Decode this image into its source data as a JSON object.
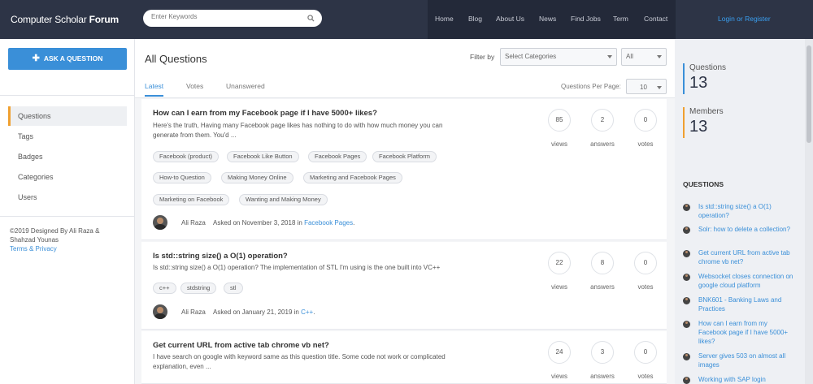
{
  "header": {
    "logo_light": "Computer Scholar ",
    "logo_bold": "Forum",
    "search_placeholder": "Enter Keywords",
    "nav": [
      "Home",
      "Blog",
      "About Us",
      "News",
      "Find Jobs",
      "Term",
      "Contact"
    ],
    "login": "Login or Register"
  },
  "sidebar": {
    "ask_button": "ASK A QUESTION",
    "menu": [
      "Questions",
      "Tags",
      "Badges",
      "Categories",
      "Users"
    ],
    "copyright": "©2019 Designed By Ali Raza & Shahzad Younas",
    "terms": "Terms & Privacy"
  },
  "main": {
    "title": "All Questions",
    "filter_label": "Filter by",
    "category_select": "Select Categories",
    "all_select": "All",
    "tabs": [
      "Latest",
      "Votes",
      "Unanswered"
    ],
    "per_page_label": "Questions Per Page:",
    "per_page_value": "10",
    "questions": [
      {
        "title": "How can I earn from my Facebook page if I have 5000+ likes?",
        "excerpt": "Here's the truth, Having many Facebook page likes has nothing to do with how much money you can generate from them. You'd ...",
        "tags": [
          "Facebook (product)",
          "Facebook Like Button",
          "Facebook Pages",
          "Facebook Platform",
          "How-to Question",
          "Making Money Online",
          "Marketing and Facebook Pages",
          "Marketing on Facebook",
          "Wanting and Making Money"
        ],
        "author": "Ali Raza",
        "asked_text": "Asked on November 3, 2018 in ",
        "category": "Facebook Pages",
        "views": "85",
        "answers": "2",
        "votes": "0"
      },
      {
        "title": "Is std::string size() a O(1) operation?",
        "excerpt": "Is std::string size() a O(1) operation? The implementation of STL I'm using is the one built into VC++",
        "tags": [
          "c++",
          "stdstring",
          "stl"
        ],
        "author": "Ali Raza",
        "asked_text": "Asked on January 21, 2019 in ",
        "category": "C++",
        "views": "22",
        "answers": "8",
        "votes": "0"
      },
      {
        "title": "Get current URL from active tab chrome vb net?",
        "excerpt": "I have search on google with keyword same as this question title. Some code not work or complicated explanation, even ...",
        "views": "24",
        "answers": "3",
        "votes": "0"
      }
    ],
    "stat_labels": {
      "views": "views",
      "answers": "answers",
      "votes": "votes"
    }
  },
  "right": {
    "questions_label": "Questions",
    "questions_count": "13",
    "members_label": "Members",
    "members_count": "13",
    "section_title": "QUESTIONS",
    "recent": [
      "Is std::string size() a O(1) operation?",
      "Solr: how to delete a collection?",
      "Get current URL from active tab chrome vb net?",
      "Websocket closes connection on google cloud platform",
      "BNK601 - Banking Laws and Practices",
      "How can I earn from my Facebook page if I have 5000+ likes?",
      "Server gives 503 on almost all images",
      "Working with SAP login"
    ]
  },
  "colors": {
    "header_bg": "#2d3446",
    "accent_blue": "#3a8fd8",
    "accent_orange": "#f0a030"
  }
}
